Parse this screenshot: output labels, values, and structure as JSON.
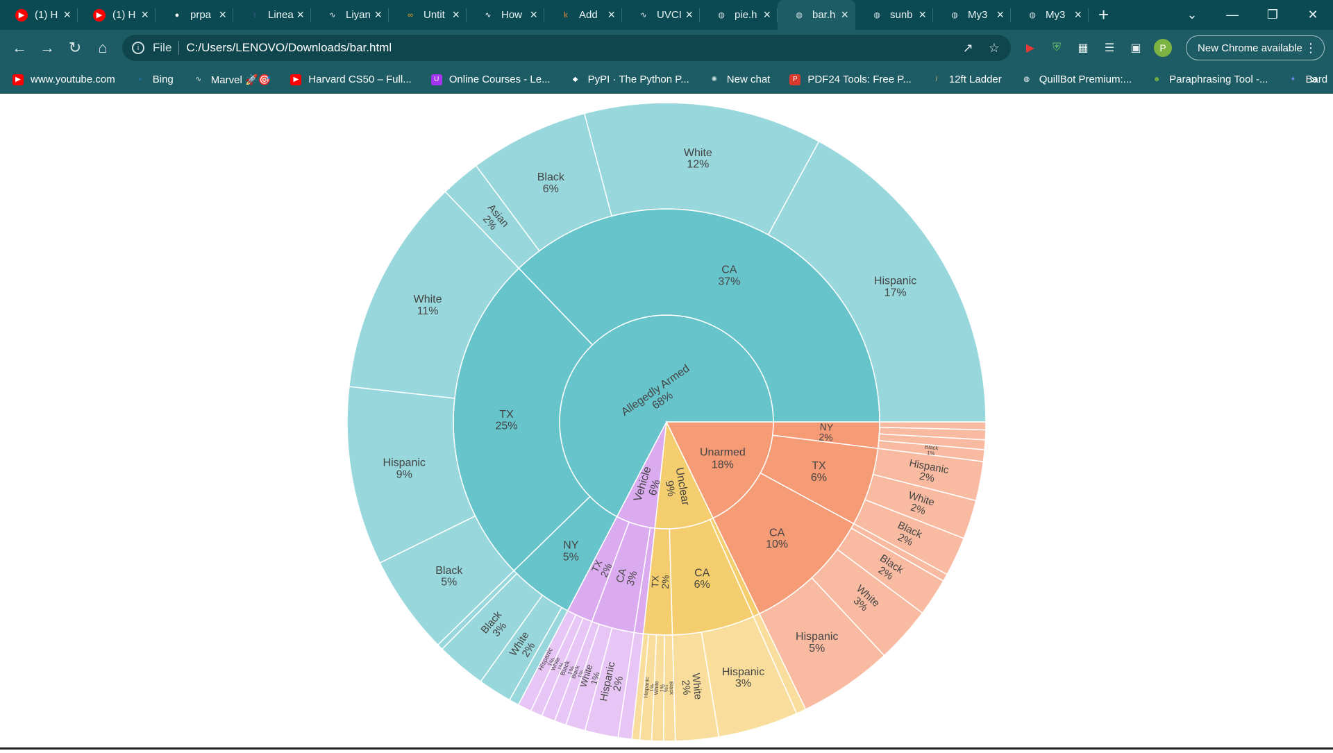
{
  "browser": {
    "tabs": [
      {
        "title": "(1) H",
        "icon": "youtube-icon",
        "color": "#ff0000",
        "active": false
      },
      {
        "title": "(1) H",
        "icon": "youtube-icon",
        "color": "#ff0000",
        "active": false
      },
      {
        "title": "prpa",
        "icon": "github-icon",
        "color": "#ffffff",
        "active": false
      },
      {
        "title": "Linea",
        "icon": "tds-icon",
        "color": "#3a5c8c",
        "active": false
      },
      {
        "title": "Liyan",
        "icon": "wave-icon",
        "color": "#ffffff",
        "active": false
      },
      {
        "title": "Untit",
        "icon": "infinity-icon",
        "color": "#f5a623",
        "active": false
      },
      {
        "title": "How",
        "icon": "wave-icon",
        "color": "#ffffff",
        "active": false
      },
      {
        "title": "Add",
        "icon": "kaggle-icon",
        "color": "#e88c3a",
        "active": false
      },
      {
        "title": "UVCI",
        "icon": "wave-icon",
        "color": "#ffffff",
        "active": false
      },
      {
        "title": "pie.h",
        "icon": "globe-icon",
        "color": "#cfe0e2",
        "active": false
      },
      {
        "title": "bar.h",
        "icon": "globe-icon",
        "color": "#cfe0e2",
        "active": true
      },
      {
        "title": "sunb",
        "icon": "globe-icon",
        "color": "#cfe0e2",
        "active": false
      },
      {
        "title": "My3",
        "icon": "globe-icon",
        "color": "#cfe0e2",
        "active": false
      },
      {
        "title": "My3",
        "icon": "globe-icon",
        "color": "#cfe0e2",
        "active": false
      }
    ],
    "address": {
      "scheme_label": "File",
      "url": "C:/Users/LENOVO/Downloads/bar.html"
    },
    "profile_initial": "P",
    "update_label": "New Chrome available",
    "bookmarks": [
      {
        "label": "www.youtube.com",
        "icon": "youtube-icon",
        "color": "#ff0000"
      },
      {
        "label": "Bing",
        "icon": "bing-search-icon",
        "color": "#2b7de9"
      },
      {
        "label": "Marvel 🚀🎯",
        "icon": "wave-icon",
        "color": "#ffffff"
      },
      {
        "label": "Harvard CS50 – Full...",
        "icon": "youtube-icon",
        "color": "#ff0000"
      },
      {
        "label": "Online Courses - Le...",
        "icon": "udemy-icon",
        "color": "#a435f0"
      },
      {
        "label": "PyPI · The Python P...",
        "icon": "pypi-icon",
        "color": "#ffffff"
      },
      {
        "label": "New chat",
        "icon": "openai-icon",
        "color": "#cfe0e2"
      },
      {
        "label": "PDF24 Tools: Free P...",
        "icon": "pdf24-icon",
        "color": "#d83a2e"
      },
      {
        "label": "12ft Ladder",
        "icon": "ladder-icon",
        "color": "#e0c080"
      },
      {
        "label": "QuillBot Premium:...",
        "icon": "quillbot-icon",
        "color": "#ffffff"
      },
      {
        "label": "Paraphrasing Tool -...",
        "icon": "robot-icon",
        "color": "#7cb342"
      },
      {
        "label": "Bard",
        "icon": "bard-sparkle-icon",
        "color": "#6c8cf5"
      }
    ]
  },
  "chart_data": {
    "type": "sunburst",
    "colors": {
      "Allegedly Armed": "#67c4cb",
      "Unarmed": "#f59b75",
      "Unclear": "#f4cd6e",
      "Vehicle": "#dbabf0"
    },
    "root": [
      {
        "name": "Allegedly Armed",
        "pct": "68%",
        "value": 68,
        "children": [
          {
            "name": "CA",
            "pct": "37%",
            "value": 37,
            "children": [
              {
                "name": "Hispanic",
                "pct": "17%",
                "value": 17
              },
              {
                "name": "White",
                "pct": "12%",
                "value": 12
              },
              {
                "name": "Black",
                "pct": "6%",
                "value": 6
              },
              {
                "name": "Asian",
                "pct": "2%",
                "value": 2
              }
            ]
          },
          {
            "name": "TX",
            "pct": "25%",
            "value": 25,
            "children": [
              {
                "name": "White",
                "pct": "11%",
                "value": 11
              },
              {
                "name": "Hispanic",
                "pct": "9%",
                "value": 9
              },
              {
                "name": "Black",
                "pct": "5%",
                "value": 5
              }
            ]
          },
          {
            "name": "NY",
            "pct": "5%",
            "value": 5,
            "children": [
              {
                "name": "",
                "pct": "",
                "value": 0.3
              },
              {
                "name": "Black",
                "pct": "3%",
                "value": 2.5
              },
              {
                "name": "White",
                "pct": "2%",
                "value": 1.7
              },
              {
                "name": "",
                "pct": "",
                "value": 0.5
              }
            ]
          }
        ]
      },
      {
        "name": "Vehicle",
        "pct": "6%",
        "value": 6,
        "children": [
          {
            "name": "TX",
            "pct": "2%",
            "value": 2,
            "children": [
              {
                "name": "Hispanic",
                "pct": "1%",
                "value": 0.7
              },
              {
                "name": "White",
                "pct": "1%",
                "value": 0.6
              },
              {
                "name": "Black",
                "pct": "1%",
                "value": 0.7
              }
            ]
          },
          {
            "name": "CA",
            "pct": "3%",
            "value": 3.3,
            "children": [
              {
                "name": "Black",
                "pct": "1%",
                "value": 0.6
              },
              {
                "name": "White",
                "pct": "1%",
                "value": 1.0
              },
              {
                "name": "Hispanic",
                "pct": "2%",
                "value": 1.7
              }
            ]
          },
          {
            "name": "",
            "pct": "",
            "value": 0.7,
            "children": [
              {
                "name": "",
                "pct": "",
                "value": 0.7
              }
            ]
          }
        ]
      },
      {
        "name": "Unclear",
        "pct": "9%",
        "value": 9,
        "children": [
          {
            "name": "TX",
            "pct": "2%",
            "value": 2.2,
            "children": [
              {
                "name": "",
                "pct": "",
                "value": 0.4
              },
              {
                "name": "Hispanic",
                "pct": "1%",
                "value": 0.6
              },
              {
                "name": "White",
                "pct": "1%",
                "value": 0.6
              },
              {
                "name": "Black",
                "pct": "1%",
                "value": 0.6
              }
            ]
          },
          {
            "name": "CA",
            "pct": "6%",
            "value": 6.3,
            "children": [
              {
                "name": "White",
                "pct": "2%",
                "value": 2.2
              },
              {
                "name": "Hispanic",
                "pct": "3%",
                "value": 4.1
              }
            ]
          },
          {
            "name": "",
            "pct": "",
            "value": 0.5,
            "children": [
              {
                "name": "",
                "pct": "",
                "value": 0.5
              }
            ]
          }
        ]
      },
      {
        "name": "Unarmed",
        "pct": "18%",
        "value": 18,
        "children": [
          {
            "name": "CA",
            "pct": "10%",
            "value": 10,
            "children": [
              {
                "name": "Hispanic",
                "pct": "5%",
                "value": 5
              },
              {
                "name": "White",
                "pct": "3%",
                "value": 3
              },
              {
                "name": "Black",
                "pct": "2%",
                "value": 2
              },
              {
                "name": "",
                "pct": "",
                "value": 0.4
              }
            ]
          },
          {
            "name": "TX",
            "pct": "6%",
            "value": 6,
            "children": [
              {
                "name": "Black",
                "pct": "2%",
                "value": 2
              },
              {
                "name": "White",
                "pct": "2%",
                "value": 2
              },
              {
                "name": "Hispanic",
                "pct": "2%",
                "value": 2
              }
            ]
          },
          {
            "name": "NY",
            "pct": "2%",
            "value": 2,
            "children": [
              {
                "name": "Black",
                "pct": "1%",
                "value": 0.6
              },
              {
                "name": "",
                "pct": "",
                "value": 0.5
              },
              {
                "name": "",
                "pct": "",
                "value": 0.5
              },
              {
                "name": "",
                "pct": "",
                "value": 0.4
              }
            ]
          }
        ]
      }
    ]
  }
}
